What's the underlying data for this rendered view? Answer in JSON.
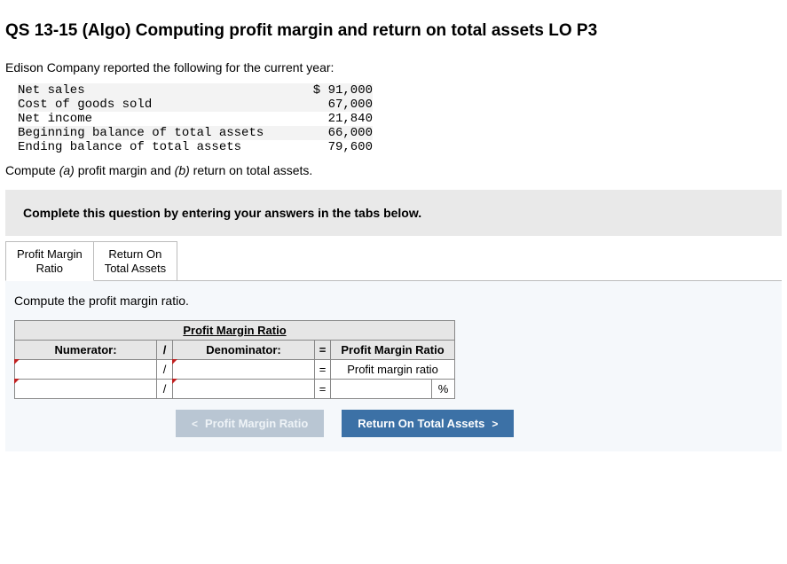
{
  "title": "QS 13-15 (Algo) Computing profit margin and return on total assets LO P3",
  "intro": "Edison Company reported the following for the current year:",
  "fin": {
    "rows": [
      {
        "label": "Net sales",
        "value": "$ 91,000",
        "shade": true
      },
      {
        "label": "Cost of goods sold",
        "value": "67,000",
        "shade": true
      },
      {
        "label": "Net income",
        "value": "21,840",
        "shade": false
      },
      {
        "label": "Beginning balance of total assets",
        "value": "66,000",
        "shade": true
      },
      {
        "label": "Ending balance of total assets",
        "value": "79,600",
        "shade": false
      }
    ]
  },
  "compute": {
    "prefix": "Compute ",
    "a": "(a)",
    "a_text": " profit margin and ",
    "b": "(b)",
    "b_text": " return on total assets."
  },
  "instr": "Complete this question by entering your answers in the tabs below.",
  "tabs": {
    "t1_l1": "Profit Margin",
    "t1_l2": "Ratio",
    "t2_l1": "Return On",
    "t2_l2": "Total Assets"
  },
  "panel": {
    "prompt": "Compute the profit margin ratio.",
    "table": {
      "title": "Profit Margin Ratio",
      "numerator": "Numerator:",
      "div": "/",
      "denominator": "Denominator:",
      "eq": "=",
      "result_hdr": "Profit Margin Ratio",
      "result_txt": "Profit margin ratio",
      "unit": "%"
    }
  },
  "nav": {
    "prev": "Profit Margin Ratio",
    "next": "Return On Total Assets",
    "chev_left": "<",
    "chev_right": ">"
  }
}
